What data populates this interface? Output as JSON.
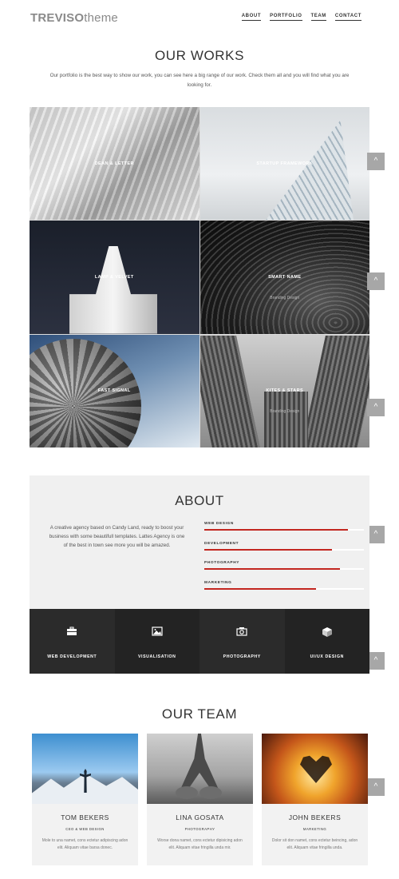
{
  "header": {
    "logo_part1": "TREVISO",
    "logo_part2": "theme",
    "nav": [
      "ABOUT",
      "PORTFOLIO",
      "TEAM",
      "CONTACT"
    ]
  },
  "works": {
    "title": "OUR WORKS",
    "description": "Our portfolio is the best way to show our work, you can see here a big range of our work. Check them all and you will find what you are looking for.",
    "items": [
      {
        "title": "DEAN & LETTER",
        "subtitle": ""
      },
      {
        "title": "STARTUP FRAMEWORK",
        "subtitle": ""
      },
      {
        "title": "LAMP & VELVET",
        "subtitle": ""
      },
      {
        "title": "SMART NAME",
        "subtitle": "Branding Design"
      },
      {
        "title": "FAST SIGNAL",
        "subtitle": ""
      },
      {
        "title": "KITES & STARS",
        "subtitle": "Branding Design"
      }
    ]
  },
  "about": {
    "title": "ABOUT",
    "text": "A creative agency based on Candy Land, ready to boost your business with some beautifull templates. Lattes Agency is one of the best in town see more you will be amazed.",
    "skills": [
      {
        "name": "WEB DESIGN",
        "percent": 90
      },
      {
        "name": "DEVELOPMENT",
        "percent": 80
      },
      {
        "name": "PHOTOGRAPHY",
        "percent": 85
      },
      {
        "name": "MARKETING",
        "percent": 70
      }
    ],
    "services": [
      {
        "label": "WEB DEVELOPMENT",
        "icon": "briefcase-icon"
      },
      {
        "label": "VISUALISATION",
        "icon": "image-icon"
      },
      {
        "label": "PHOTOGRAPHY",
        "icon": "camera-icon"
      },
      {
        "label": "UI/UX DESIGN",
        "icon": "cube-icon"
      }
    ]
  },
  "team": {
    "title": "OUR TEAM",
    "members": [
      {
        "name": "TOM BEKERS",
        "role": "CEO & WEB DESIGN",
        "bio": "Mole to una namet, cons ectetur adipiscing adon elit. Aliquam vitae barsa donec."
      },
      {
        "name": "LINA GOSATA",
        "role": "PHOTOGRAPHY",
        "bio": "Worse dona namet, cons ectetur dipisicing adon elit. Aliquam vitae fringilla unda mir."
      },
      {
        "name": "JOHN BEKERS",
        "role": "MARKETING",
        "bio": "Dolor sit don namet, cons ectetur beincing, adon elit. Aliquam vitae fringilla unda."
      }
    ]
  },
  "side_button_arrow": "^",
  "colors": {
    "accent": "#c32720",
    "dark": "#2b2b2b",
    "light_bg": "#f0f0f0"
  }
}
